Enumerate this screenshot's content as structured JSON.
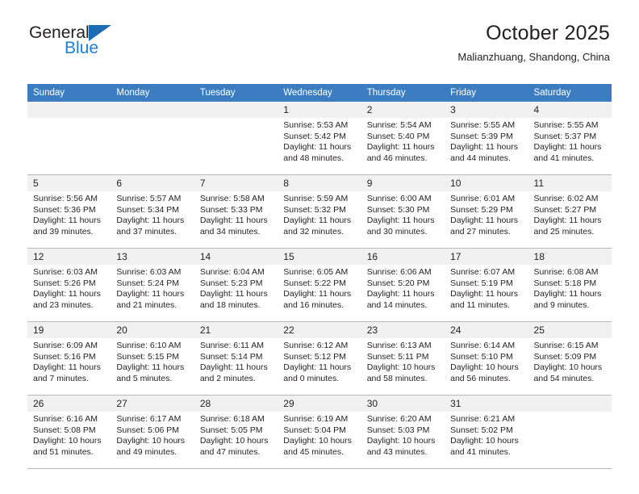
{
  "brand": {
    "name_part1": "General",
    "name_part2": "Blue",
    "triangle_color": "#1b6cb5",
    "blue_color": "#1b7fd4"
  },
  "header": {
    "title": "October 2025",
    "subtitle": "Malianzhuang, Shandong, China",
    "header_bg": "#3b7dc0",
    "daynum_bg": "#f1f1f1"
  },
  "weekdays": [
    "Sunday",
    "Monday",
    "Tuesday",
    "Wednesday",
    "Thursday",
    "Friday",
    "Saturday"
  ],
  "labels": {
    "sunrise": "Sunrise:",
    "sunset": "Sunset:",
    "daylight": "Daylight:"
  },
  "weeks": [
    [
      {
        "day": "",
        "empty": true
      },
      {
        "day": "",
        "empty": true
      },
      {
        "day": "",
        "empty": true
      },
      {
        "day": "1",
        "sunrise": "Sunrise: 5:53 AM",
        "sunset": "Sunset: 5:42 PM",
        "daylight_1": "Daylight: 11 hours",
        "daylight_2": "and 48 minutes."
      },
      {
        "day": "2",
        "sunrise": "Sunrise: 5:54 AM",
        "sunset": "Sunset: 5:40 PM",
        "daylight_1": "Daylight: 11 hours",
        "daylight_2": "and 46 minutes."
      },
      {
        "day": "3",
        "sunrise": "Sunrise: 5:55 AM",
        "sunset": "Sunset: 5:39 PM",
        "daylight_1": "Daylight: 11 hours",
        "daylight_2": "and 44 minutes."
      },
      {
        "day": "4",
        "sunrise": "Sunrise: 5:55 AM",
        "sunset": "Sunset: 5:37 PM",
        "daylight_1": "Daylight: 11 hours",
        "daylight_2": "and 41 minutes."
      }
    ],
    [
      {
        "day": "5",
        "sunrise": "Sunrise: 5:56 AM",
        "sunset": "Sunset: 5:36 PM",
        "daylight_1": "Daylight: 11 hours",
        "daylight_2": "and 39 minutes."
      },
      {
        "day": "6",
        "sunrise": "Sunrise: 5:57 AM",
        "sunset": "Sunset: 5:34 PM",
        "daylight_1": "Daylight: 11 hours",
        "daylight_2": "and 37 minutes."
      },
      {
        "day": "7",
        "sunrise": "Sunrise: 5:58 AM",
        "sunset": "Sunset: 5:33 PM",
        "daylight_1": "Daylight: 11 hours",
        "daylight_2": "and 34 minutes."
      },
      {
        "day": "8",
        "sunrise": "Sunrise: 5:59 AM",
        "sunset": "Sunset: 5:32 PM",
        "daylight_1": "Daylight: 11 hours",
        "daylight_2": "and 32 minutes."
      },
      {
        "day": "9",
        "sunrise": "Sunrise: 6:00 AM",
        "sunset": "Sunset: 5:30 PM",
        "daylight_1": "Daylight: 11 hours",
        "daylight_2": "and 30 minutes."
      },
      {
        "day": "10",
        "sunrise": "Sunrise: 6:01 AM",
        "sunset": "Sunset: 5:29 PM",
        "daylight_1": "Daylight: 11 hours",
        "daylight_2": "and 27 minutes."
      },
      {
        "day": "11",
        "sunrise": "Sunrise: 6:02 AM",
        "sunset": "Sunset: 5:27 PM",
        "daylight_1": "Daylight: 11 hours",
        "daylight_2": "and 25 minutes."
      }
    ],
    [
      {
        "day": "12",
        "sunrise": "Sunrise: 6:03 AM",
        "sunset": "Sunset: 5:26 PM",
        "daylight_1": "Daylight: 11 hours",
        "daylight_2": "and 23 minutes."
      },
      {
        "day": "13",
        "sunrise": "Sunrise: 6:03 AM",
        "sunset": "Sunset: 5:24 PM",
        "daylight_1": "Daylight: 11 hours",
        "daylight_2": "and 21 minutes."
      },
      {
        "day": "14",
        "sunrise": "Sunrise: 6:04 AM",
        "sunset": "Sunset: 5:23 PM",
        "daylight_1": "Daylight: 11 hours",
        "daylight_2": "and 18 minutes."
      },
      {
        "day": "15",
        "sunrise": "Sunrise: 6:05 AM",
        "sunset": "Sunset: 5:22 PM",
        "daylight_1": "Daylight: 11 hours",
        "daylight_2": "and 16 minutes."
      },
      {
        "day": "16",
        "sunrise": "Sunrise: 6:06 AM",
        "sunset": "Sunset: 5:20 PM",
        "daylight_1": "Daylight: 11 hours",
        "daylight_2": "and 14 minutes."
      },
      {
        "day": "17",
        "sunrise": "Sunrise: 6:07 AM",
        "sunset": "Sunset: 5:19 PM",
        "daylight_1": "Daylight: 11 hours",
        "daylight_2": "and 11 minutes."
      },
      {
        "day": "18",
        "sunrise": "Sunrise: 6:08 AM",
        "sunset": "Sunset: 5:18 PM",
        "daylight_1": "Daylight: 11 hours",
        "daylight_2": "and 9 minutes."
      }
    ],
    [
      {
        "day": "19",
        "sunrise": "Sunrise: 6:09 AM",
        "sunset": "Sunset: 5:16 PM",
        "daylight_1": "Daylight: 11 hours",
        "daylight_2": "and 7 minutes."
      },
      {
        "day": "20",
        "sunrise": "Sunrise: 6:10 AM",
        "sunset": "Sunset: 5:15 PM",
        "daylight_1": "Daylight: 11 hours",
        "daylight_2": "and 5 minutes."
      },
      {
        "day": "21",
        "sunrise": "Sunrise: 6:11 AM",
        "sunset": "Sunset: 5:14 PM",
        "daylight_1": "Daylight: 11 hours",
        "daylight_2": "and 2 minutes."
      },
      {
        "day": "22",
        "sunrise": "Sunrise: 6:12 AM",
        "sunset": "Sunset: 5:12 PM",
        "daylight_1": "Daylight: 11 hours",
        "daylight_2": "and 0 minutes."
      },
      {
        "day": "23",
        "sunrise": "Sunrise: 6:13 AM",
        "sunset": "Sunset: 5:11 PM",
        "daylight_1": "Daylight: 10 hours",
        "daylight_2": "and 58 minutes."
      },
      {
        "day": "24",
        "sunrise": "Sunrise: 6:14 AM",
        "sunset": "Sunset: 5:10 PM",
        "daylight_1": "Daylight: 10 hours",
        "daylight_2": "and 56 minutes."
      },
      {
        "day": "25",
        "sunrise": "Sunrise: 6:15 AM",
        "sunset": "Sunset: 5:09 PM",
        "daylight_1": "Daylight: 10 hours",
        "daylight_2": "and 54 minutes."
      }
    ],
    [
      {
        "day": "26",
        "sunrise": "Sunrise: 6:16 AM",
        "sunset": "Sunset: 5:08 PM",
        "daylight_1": "Daylight: 10 hours",
        "daylight_2": "and 51 minutes."
      },
      {
        "day": "27",
        "sunrise": "Sunrise: 6:17 AM",
        "sunset": "Sunset: 5:06 PM",
        "daylight_1": "Daylight: 10 hours",
        "daylight_2": "and 49 minutes."
      },
      {
        "day": "28",
        "sunrise": "Sunrise: 6:18 AM",
        "sunset": "Sunset: 5:05 PM",
        "daylight_1": "Daylight: 10 hours",
        "daylight_2": "and 47 minutes."
      },
      {
        "day": "29",
        "sunrise": "Sunrise: 6:19 AM",
        "sunset": "Sunset: 5:04 PM",
        "daylight_1": "Daylight: 10 hours",
        "daylight_2": "and 45 minutes."
      },
      {
        "day": "30",
        "sunrise": "Sunrise: 6:20 AM",
        "sunset": "Sunset: 5:03 PM",
        "daylight_1": "Daylight: 10 hours",
        "daylight_2": "and 43 minutes."
      },
      {
        "day": "31",
        "sunrise": "Sunrise: 6:21 AM",
        "sunset": "Sunset: 5:02 PM",
        "daylight_1": "Daylight: 10 hours",
        "daylight_2": "and 41 minutes."
      },
      {
        "day": "",
        "empty": true
      }
    ]
  ]
}
